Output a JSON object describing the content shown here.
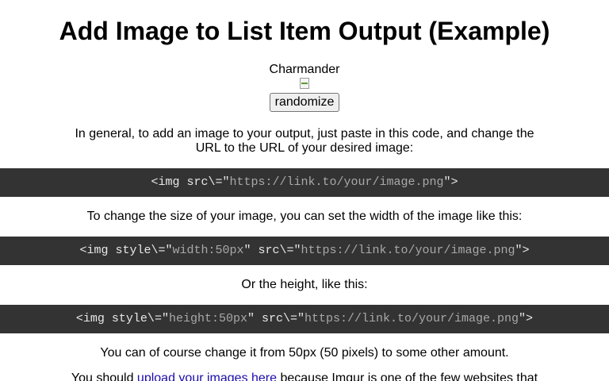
{
  "title": "Add Image to List Item Output (Example)",
  "output": {
    "name": "Charmander",
    "randomize_label": "randomize"
  },
  "p_general": "In general, to add an image to your output, just paste in this code, and change the URL to the URL of your desired image:",
  "code1": {
    "pre": "<img src\\=\"",
    "url": "https://link.to/your/image.png",
    "post": "\">"
  },
  "p_width": "To change the size of your image, you can set the width of the image like this:",
  "code2": {
    "pre": "<img style\\=\"",
    "style": "width:50px",
    "mid": "\" src\\=\"",
    "url": "https://link.to/your/image.png",
    "post": "\">"
  },
  "p_height": "Or the height, like this:",
  "code3": {
    "pre": "<img style\\=\"",
    "style": "height:50px",
    "mid": "\" src\\=\"",
    "url": "https://link.to/your/image.png",
    "post": "\">"
  },
  "p_change": "You can of course change it from 50px (50 pixels) to some other amount.",
  "p_upload": {
    "pre": "You should ",
    "link": "upload your images here",
    "post": " because Imgur is one of the few websites that"
  }
}
